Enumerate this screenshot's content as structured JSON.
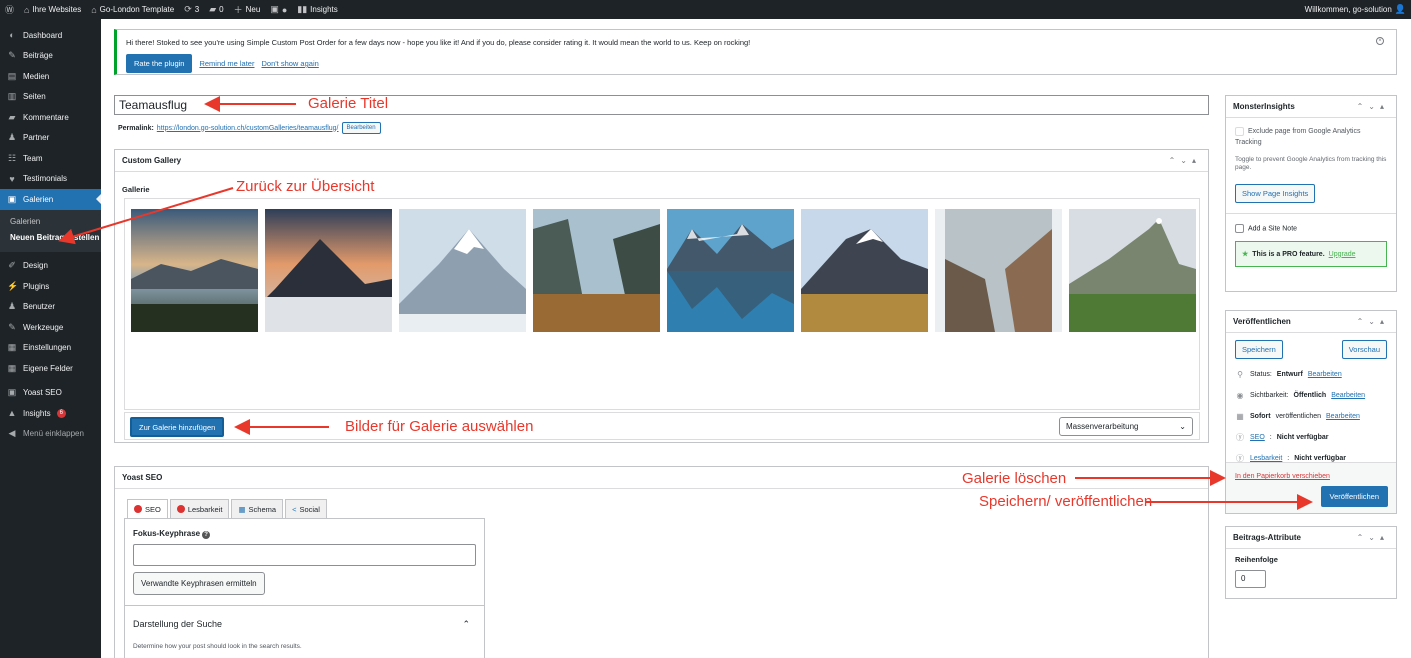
{
  "adminbar": {
    "wp_logo": "wordpress-icon",
    "sites": "Ihre Websites",
    "site_name": "Go-London Template",
    "updates": "3",
    "comments": "0",
    "new": "Neu",
    "insights": "Insights",
    "welcome": "Willkommen, go-solution"
  },
  "sidebar": {
    "items": [
      {
        "label": "Dashboard",
        "icon": "dashboard-icon"
      },
      {
        "label": "Beiträge",
        "icon": "pin-icon"
      },
      {
        "label": "Medien",
        "icon": "media-icon"
      },
      {
        "label": "Seiten",
        "icon": "pages-icon"
      },
      {
        "label": "Kommentare",
        "icon": "comments-icon"
      },
      {
        "label": "Partner",
        "icon": "user-icon"
      },
      {
        "label": "Team",
        "icon": "team-icon"
      },
      {
        "label": "Testimonials",
        "icon": "heart-icon"
      },
      {
        "label": "Galerien",
        "icon": "gallery-icon"
      }
    ],
    "submenu": [
      "Galerien",
      "Neuen Beitrag erstellen"
    ],
    "items2": [
      {
        "label": "Design",
        "icon": "brush-icon"
      },
      {
        "label": "Plugins",
        "icon": "plug-icon"
      },
      {
        "label": "Benutzer",
        "icon": "users-icon"
      },
      {
        "label": "Werkzeuge",
        "icon": "wrench-icon"
      },
      {
        "label": "Einstellungen",
        "icon": "settings-icon"
      },
      {
        "label": "Eigene Felder",
        "icon": "fields-icon"
      },
      {
        "label": "Yoast SEO",
        "icon": "yoast-icon"
      },
      {
        "label": "Insights",
        "icon": "insights-icon",
        "badge": "6"
      },
      {
        "label": "Menü einklappen",
        "icon": "collapse-icon"
      }
    ]
  },
  "notice": {
    "text": "Hi there! Stoked to see you're using Simple Custom Post Order for a few days now - hope you like it! And if you do, please consider rating it. It would mean the world to us. Keep on rocking!",
    "rate": "Rate the plugin",
    "remind": "Remind me later",
    "dont_show": "Don't show again"
  },
  "post": {
    "title": "Teamausflug",
    "permalink_label": "Permalink:",
    "permalink_url": "https://london.go-solution.ch/customGalleries/teamausflug/",
    "edit": "Bearbeiten"
  },
  "gallery": {
    "box_title": "Custom Gallery",
    "label": "Gallerie",
    "add_button": "Zur Galerie hinzufügen",
    "bulk_select": "Massenverarbeitung"
  },
  "yoast": {
    "title": "Yoast SEO",
    "tabs": [
      "SEO",
      "Lesbarkeit",
      "Schema",
      "Social"
    ],
    "keyphrase_label": "Fokus-Keyphrase",
    "related_button": "Verwandte Keyphrasen ermitteln",
    "search_section": "Darstellung der Suche",
    "search_desc": "Determine how your post should look in the search results."
  },
  "monsterinsights": {
    "title": "MonsterInsights",
    "exclude": "Exclude page from Google Analytics Tracking",
    "toggle_desc": "Toggle to prevent Google Analytics from tracking this page.",
    "show_insights": "Show Page Insights",
    "site_note": "Add a Site Note",
    "pro": "This is a PRO feature.",
    "upgrade": "Upgrade"
  },
  "publish": {
    "title": "Veröffentlichen",
    "save": "Speichern",
    "preview": "Vorschau",
    "status_label": "Status:",
    "status_value": "Entwurf",
    "visibility_label": "Sichtbarkeit:",
    "visibility_value": "Öffentlich",
    "immediately": "Sofort",
    "publish_suffix": "veröffentlichen",
    "seo_label": "SEO",
    "seo_value": "Nicht verfügbar",
    "readability_label": "Lesbarkeit",
    "readability_value": "Nicht verfügbar",
    "edit": "Bearbeiten",
    "trash": "In den Papierkorb verschieben",
    "publish_button": "Veröffentlichen"
  },
  "attributes": {
    "title": "Beitrags-Attribute",
    "order_label": "Reihenfolge",
    "order_value": "0"
  },
  "annotations": {
    "gallery_title": "Galerie Titel",
    "back": "Zurück zur Übersicht",
    "select_images": "Bilder für Galerie auswählen",
    "delete": "Galerie löschen",
    "save_publish": "Speichern/ veröffentlichen",
    "color": "#e8382c"
  },
  "colors": {
    "admin_dark": "#1d2327",
    "accent": "#2271b1",
    "notice_green": "#00a32a",
    "danger": "#d63638"
  }
}
